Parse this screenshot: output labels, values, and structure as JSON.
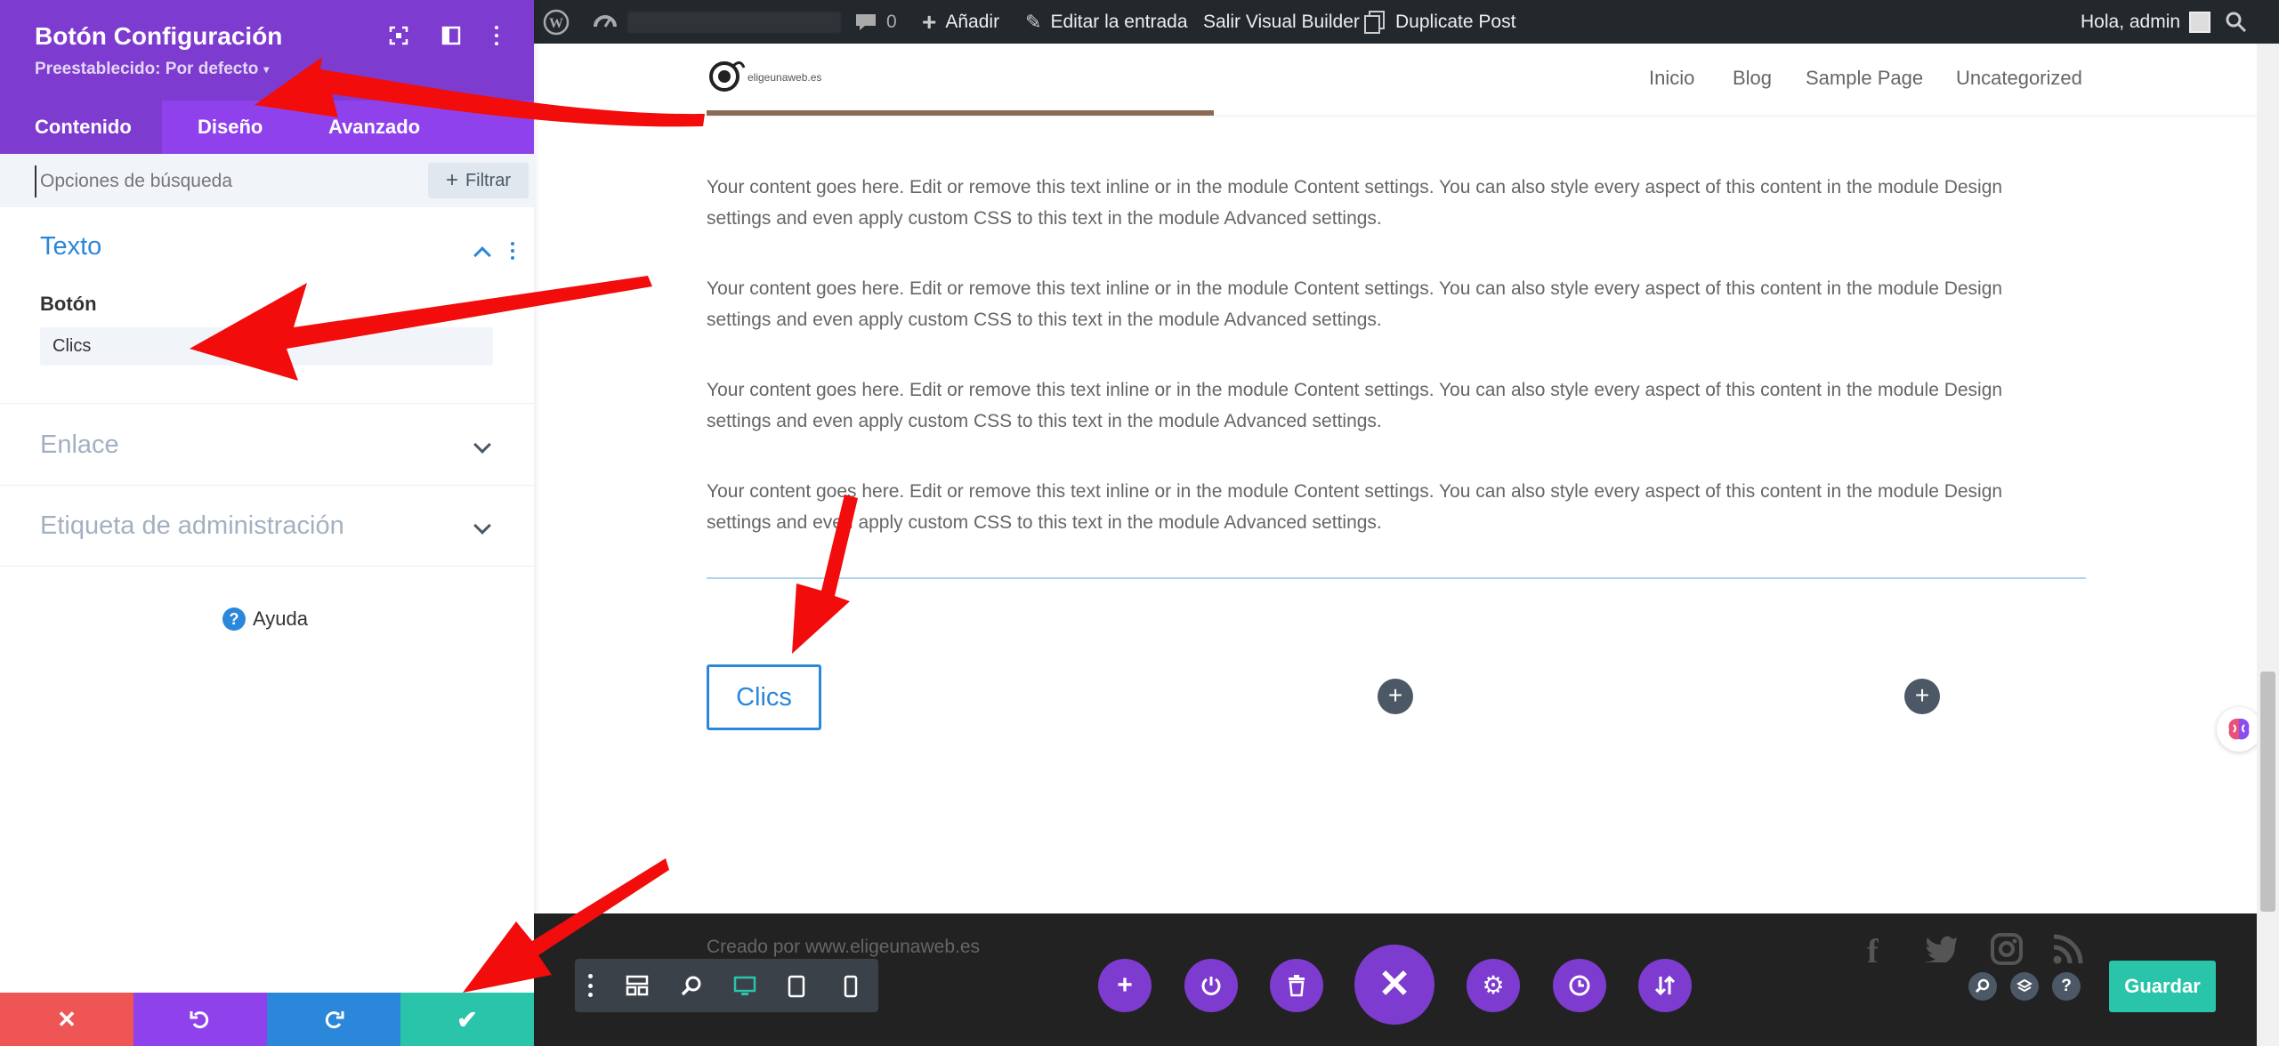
{
  "admin_bar": {
    "comments_count": "0",
    "add_label": "Añadir",
    "edit_entry_label": "Editar la entrada",
    "exit_builder_label": "Salir Visual Builder",
    "duplicate_label": "Duplicate Post",
    "greeting": "Hola, admin"
  },
  "site": {
    "logo_text": "eligeunaweb.es",
    "nav": [
      "Inicio",
      "Blog",
      "Sample Page",
      "Uncategorized"
    ]
  },
  "content": {
    "paragraphs": [
      {
        "line1": "Your content goes here. Edit or remove this text inline or in the module Content settings. You can also style every aspect of this content in the module Design",
        "line2": "settings and even apply custom CSS to this text in the module Advanced settings."
      },
      {
        "line1": "Your content goes here. Edit or remove this text inline or in the module Content settings. You can also style every aspect of this content in the module Design",
        "line2": "settings and even apply custom CSS to this text in the module Advanced settings."
      },
      {
        "line1": "Your content goes here. Edit or remove this text inline or in the module Content settings. You can also style every aspect of this content in the module Design",
        "line2": "settings and even apply custom CSS to this text in the module Advanced settings."
      },
      {
        "line1": "Your content goes here. Edit or remove this text inline or in the module Content settings. You can also style every aspect of this content in the module Design",
        "line2": "settings and even apply custom CSS to this text in the module Advanced settings."
      }
    ],
    "button_label": "Clics",
    "footer_credit": "Creado por www.eligeunaweb.es"
  },
  "panel": {
    "title": "Botón Configuración",
    "preset": "Preestablecido: Por defecto",
    "tabs": [
      "Contenido",
      "Diseño",
      "Avanzado"
    ],
    "search_placeholder": "Opciones de búsqueda",
    "filter_label": "Filtrar",
    "sections": {
      "text_title": "Texto",
      "button_field_label": "Botón",
      "button_field_value": "Clics",
      "link_title": "Enlace",
      "admin_label_title": "Etiqueta de administración"
    },
    "help_label": "Ayuda"
  },
  "builder": {
    "save_label": "Guardar"
  },
  "colors": {
    "purple": "#7e3bd0",
    "purple_light": "#8f42ec",
    "blue": "#2b87da",
    "teal": "#29c4a9",
    "red": "#ef5555",
    "admin_bar": "#23282d"
  }
}
